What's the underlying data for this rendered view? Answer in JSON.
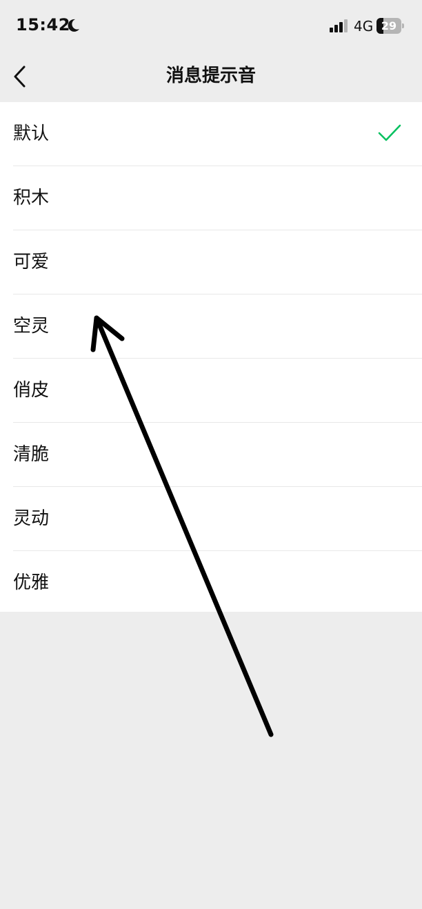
{
  "status_bar": {
    "time": "15:42",
    "network": "4G",
    "battery": "29",
    "battery_level": 0.29
  },
  "nav": {
    "title": "消息提示音"
  },
  "sounds": [
    {
      "label": "默认",
      "selected": true
    },
    {
      "label": "积木",
      "selected": false
    },
    {
      "label": "可爱",
      "selected": false
    },
    {
      "label": "空灵",
      "selected": false
    },
    {
      "label": "俏皮",
      "selected": false
    },
    {
      "label": "清脆",
      "selected": false
    },
    {
      "label": "灵动",
      "selected": false
    },
    {
      "label": "优雅",
      "selected": false
    }
  ],
  "colors": {
    "accent": "#07c160",
    "background": "#ededed",
    "list_background": "#ffffff"
  },
  "icons": {
    "back": "chevron-left-icon",
    "check": "check-icon",
    "moon": "moon-icon",
    "signal": "signal-icon"
  }
}
